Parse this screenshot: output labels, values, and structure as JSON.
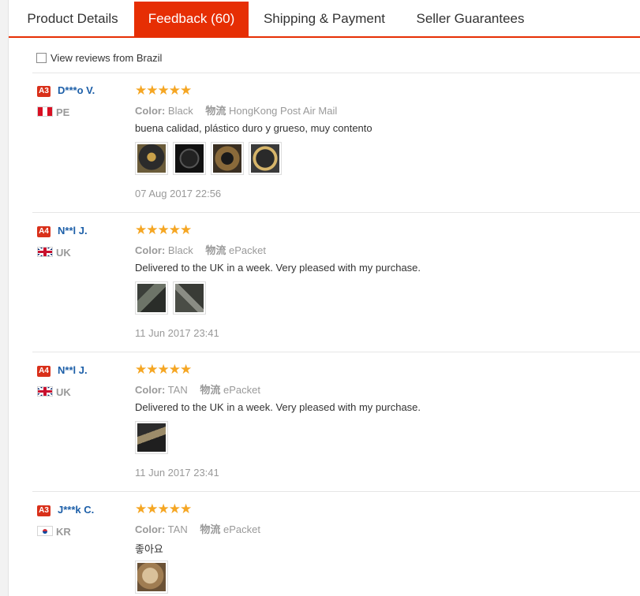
{
  "tabs": [
    {
      "label": "Product Details",
      "active": false
    },
    {
      "label": "Feedback (60)",
      "active": true
    },
    {
      "label": "Shipping & Payment",
      "active": false
    },
    {
      "label": "Seller Guarantees",
      "active": false
    }
  ],
  "filter": {
    "label": "View reviews from Brazil",
    "checked": false
  },
  "colors": {
    "accent": "#e62e04",
    "star": "#f5a623",
    "username": "#1d5fa8",
    "level_badge": "#d9301a"
  },
  "reviews": [
    {
      "level": "A3",
      "name": "D***o V.",
      "country": "PE",
      "flag_icon": "peru-flag-icon",
      "stars": "★★★★★",
      "rating": 5,
      "color_label": "Color:",
      "color": "Black",
      "ship_label": "物流",
      "shipping": "HongKong Post Air Mail",
      "text": "buena calidad, plástico duro y grueso, muy contento",
      "photos": [
        "review-photo",
        "review-photo",
        "review-photo",
        "review-photo"
      ],
      "date": "07 Aug 2017 22:56"
    },
    {
      "level": "A4",
      "name": "N**l J.",
      "country": "UK",
      "flag_icon": "uk-flag-icon",
      "stars": "★★★★★",
      "rating": 5,
      "color_label": "Color:",
      "color": "Black",
      "ship_label": "物流",
      "shipping": "ePacket",
      "text": "Delivered to the UK in a week. Very pleased with my purchase.",
      "photos": [
        "review-photo",
        "review-photo"
      ],
      "date": "11 Jun 2017 23:41"
    },
    {
      "level": "A4",
      "name": "N**l J.",
      "country": "UK",
      "flag_icon": "uk-flag-icon",
      "stars": "★★★★★",
      "rating": 5,
      "color_label": "Color:",
      "color": "TAN",
      "ship_label": "物流",
      "shipping": "ePacket",
      "text": "Delivered to the UK in a week. Very pleased with my purchase.",
      "photos": [
        "review-photo"
      ],
      "date": "11 Jun 2017 23:41"
    },
    {
      "level": "A3",
      "name": "J***k C.",
      "country": "KR",
      "flag_icon": "korea-flag-icon",
      "stars": "★★★★★",
      "rating": 5,
      "color_label": "Color:",
      "color": "TAN",
      "ship_label": "物流",
      "shipping": "ePacket",
      "text": "좋아요",
      "photos": [
        "review-photo"
      ]
    }
  ]
}
